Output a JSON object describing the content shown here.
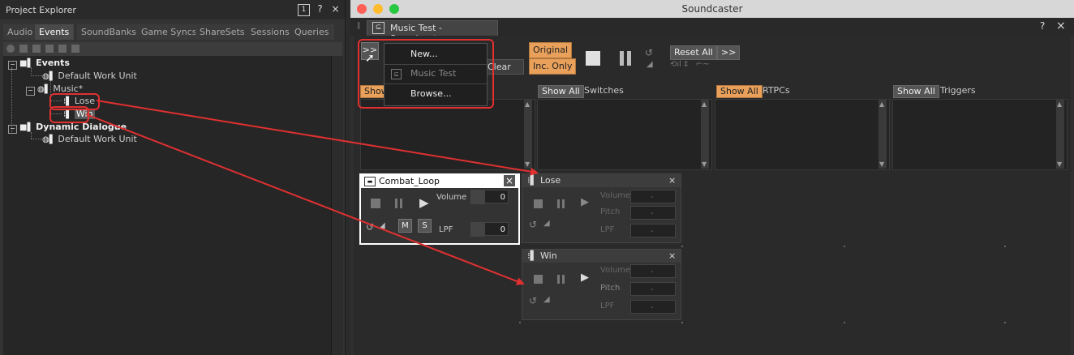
{
  "project_explorer": {
    "title": "Project Explorer",
    "tabs": [
      "Audio",
      "Events",
      "SoundBanks",
      "Game Syncs",
      "ShareSets",
      "Sessions",
      "Queries"
    ],
    "tree": {
      "events": "Events",
      "default_work_unit_1": "Default Work Unit",
      "music": "Music*",
      "lose": "Lose",
      "win": "Win",
      "dynamic_dialogue": "Dynamic Dialogue",
      "default_work_unit_2": "Default Work Unit"
    }
  },
  "soundcaster": {
    "window_title": "Soundcaster",
    "tab_title": "Music Test - Soundcaster",
    "toolbar": {
      "expand": ">>",
      "clear": "Clear",
      "original": "Original",
      "inc_only": "Inc. Only",
      "reset_all": "Reset All",
      "more": ">>"
    },
    "menu": {
      "new": "New...",
      "music_test": "Music Test",
      "browse": "Browse..."
    },
    "panels": {
      "show_all": "Show All",
      "switches": "Switches",
      "rtpcs": "RTPCs",
      "triggers": "Triggers"
    },
    "cards": {
      "combat_loop": {
        "title": "Combat_Loop",
        "volume_label": "Volume",
        "volume_value": "0",
        "lpf_label": "LPF",
        "lpf_value": "0",
        "mute": "M",
        "solo": "S"
      },
      "lose": {
        "title": "Lose",
        "volume_label": "Volume",
        "pitch_label": "Pitch",
        "lpf_label": "LPF",
        "placeholder": "-"
      },
      "win": {
        "title": "Win",
        "volume_label": "Volume",
        "pitch_label": "Pitch",
        "lpf_label": "LPF",
        "placeholder": "-"
      }
    },
    "close_glyph": "×",
    "help_glyph": "?"
  },
  "colors": {
    "accent_orange": "#e8a05a",
    "callout_red": "#e03030"
  }
}
